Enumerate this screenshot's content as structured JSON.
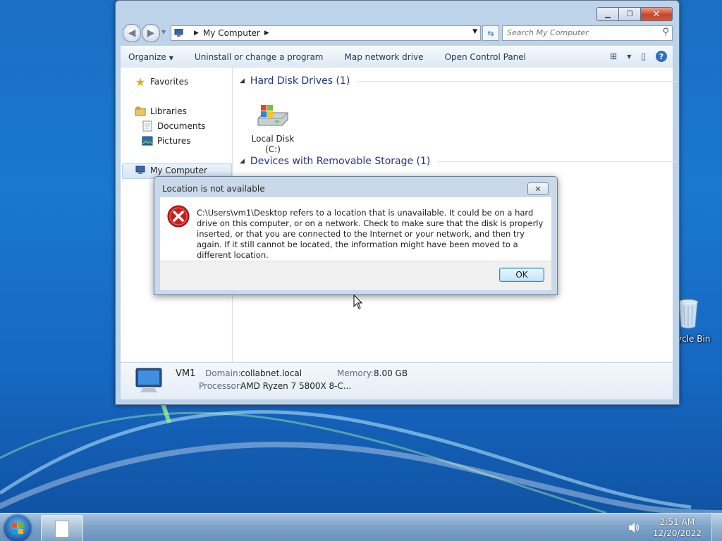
{
  "explorer": {
    "address": {
      "root": "My Computer"
    },
    "search": {
      "placeholder": "Search My Computer"
    },
    "commands": [
      "Organize",
      "Uninstall or change a program",
      "Map network drive",
      "Open Control Panel"
    ],
    "nav": {
      "favorites": "Favorites",
      "libraries": "Libraries",
      "documents": "Documents",
      "pictures": "Pictures",
      "computer": "My Computer"
    },
    "groups": {
      "hdd": "Hard Disk Drives (1)",
      "removable": "Devices with Removable Storage (1)"
    },
    "drive": {
      "name": "Local Disk",
      "letter": "(C:)"
    },
    "details": {
      "name": "VM1",
      "domain_label": "Domain:",
      "domain_value": "collabnet.local",
      "memory_label": "Memory:",
      "memory_value": "8.00 GB",
      "processor_label": "Processor:",
      "processor_value": "AMD Ryzen 7 5800X 8-C..."
    }
  },
  "dialog": {
    "title": "Location is not available",
    "message": "C:\\Users\\vm1\\Desktop refers to a location that is unavailable. It could be on a hard drive on this computer, or on a network. Check to make sure that the disk is properly inserted, or that you are connected to the Internet or your network, and then try again. If it still cannot be located, the information might have been moved to a different location.",
    "ok": "OK"
  },
  "desktop": {
    "recycle_bin_label": "ycle Bin"
  },
  "taskbar": {
    "time": "2:51 AM",
    "date": "12/20/2022"
  },
  "colors": {
    "desktop": "#1a78cf",
    "window_frame": "#bcd3ea",
    "link": "#1e3287",
    "error": "#c81e1e"
  },
  "icons": [
    "back-icon",
    "forward-icon",
    "computer-icon",
    "refresh-icon",
    "search-icon",
    "views-icon",
    "preview-pane-icon",
    "help-icon",
    "star-icon",
    "library-icon",
    "documents-icon",
    "pictures-icon",
    "hard-disk-icon",
    "error-icon",
    "recycle-bin-icon",
    "start-orb-icon",
    "speaker-icon"
  ]
}
